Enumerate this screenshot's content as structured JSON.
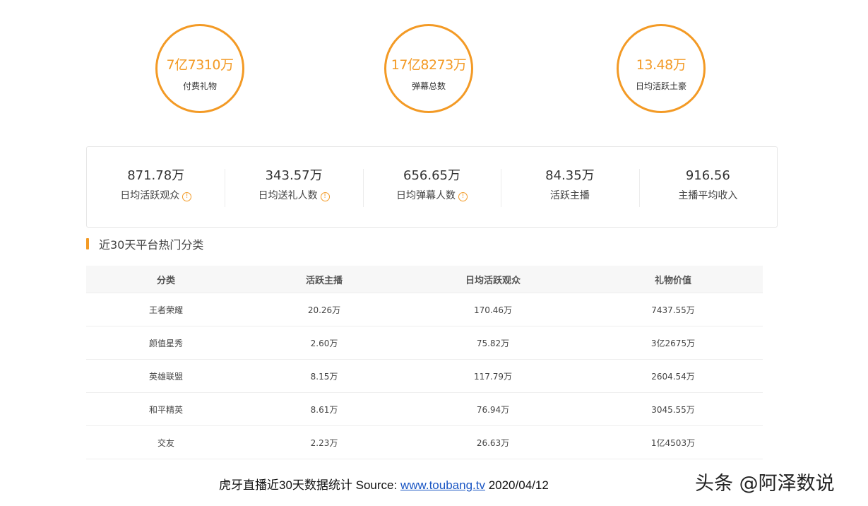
{
  "circles": [
    {
      "value": "7亿7310万",
      "label": "付费礼物"
    },
    {
      "value": "17亿8273万",
      "label": "弹幕总数"
    },
    {
      "value": "13.48万",
      "label": "日均活跃土豪"
    }
  ],
  "stats": [
    {
      "value": "871.78万",
      "label": "日均活跃观众",
      "info": true
    },
    {
      "value": "343.57万",
      "label": "日均送礼人数",
      "info": true
    },
    {
      "value": "656.65万",
      "label": "日均弹幕人数",
      "info": true
    },
    {
      "value": "84.35万",
      "label": "活跃主播",
      "info": false
    },
    {
      "value": "916.56",
      "label": "主播平均收入",
      "info": false
    }
  ],
  "section_title": "近30天平台热门分类",
  "table": {
    "headers": [
      "分类",
      "活跃主播",
      "日均活跃观众",
      "礼物价值"
    ],
    "rows": [
      [
        "王者荣耀",
        "20.26万",
        "170.46万",
        "7437.55万"
      ],
      [
        "颜值星秀",
        "2.60万",
        "75.82万",
        "3亿2675万"
      ],
      [
        "英雄联盟",
        "8.15万",
        "117.79万",
        "2604.54万"
      ],
      [
        "和平精英",
        "8.61万",
        "76.94万",
        "3045.55万"
      ],
      [
        "交友",
        "2.23万",
        "26.63万",
        "1亿4503万"
      ]
    ]
  },
  "caption": {
    "prefix": "虎牙直播近30天数据统计 Source: ",
    "link": "www.toubang.tv",
    "suffix": " 2020/04/12"
  },
  "watermark": "头条 @阿泽数说",
  "colors": {
    "accent": "#f39a25",
    "link": "#1a56c4"
  },
  "icons": {
    "info": "info-circle-icon",
    "info_glyph": "!"
  }
}
